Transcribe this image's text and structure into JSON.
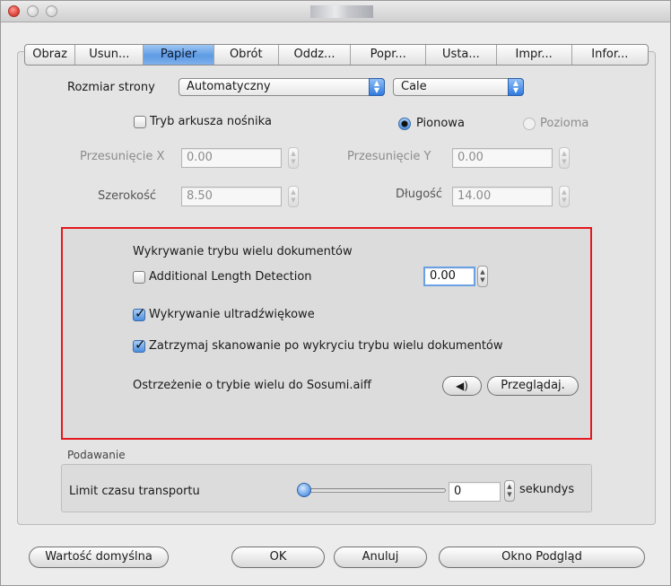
{
  "tabs": [
    "Obraz",
    "Usun...",
    "Papier",
    "Obrót",
    "Oddz...",
    "Popr...",
    "Usta...",
    "Impr...",
    "Infor..."
  ],
  "active_tab": "Papier",
  "page_size": {
    "label": "Rozmiar strony",
    "selected": "Automatyczny",
    "unit_selected": "Cale"
  },
  "carrier_mode": {
    "label": "Tryb arkusza nośnika",
    "checked": false
  },
  "orientation": {
    "portrait": "Pionowa",
    "landscape": "Pozioma",
    "selected": "Pionowa"
  },
  "offset_x": {
    "label": "Przesunięcie X",
    "value": "0.00"
  },
  "offset_y": {
    "label": "Przesunięcie Y",
    "value": "0.00"
  },
  "width": {
    "label": "Szerokość",
    "value": "8.50"
  },
  "length": {
    "label": "Długość",
    "value": "14.00"
  },
  "multifeed": {
    "heading": "Wykrywanie trybu wielu dokumentów",
    "additional_length": {
      "label": "Additional Length Detection",
      "checked": false,
      "value": "0.00"
    },
    "ultrasonic": {
      "label": "Wykrywanie ultradźwiękowe",
      "checked": true
    },
    "stop_scan": {
      "label": "Zatrzymaj skanowanie po wykryciu trybu wielu dokumentów",
      "checked": true
    },
    "alert": {
      "label": "Ostrzeżenie o trybie wielu do Sosumi.aiff",
      "browse_button": "Przeglądaj."
    }
  },
  "feeding": {
    "group_label": "Podawanie",
    "timeout_label": "Limit czasu transportu",
    "timeout_value": "0",
    "unit": "sekundys",
    "slider_level": 0
  },
  "buttons": {
    "default": "Wartość domyślna",
    "ok": "OK",
    "cancel": "Anuluj",
    "preview": "Okno Podgląd"
  },
  "colors": {
    "accent": "#5e9be4",
    "highlight_border": "#e3191f"
  }
}
